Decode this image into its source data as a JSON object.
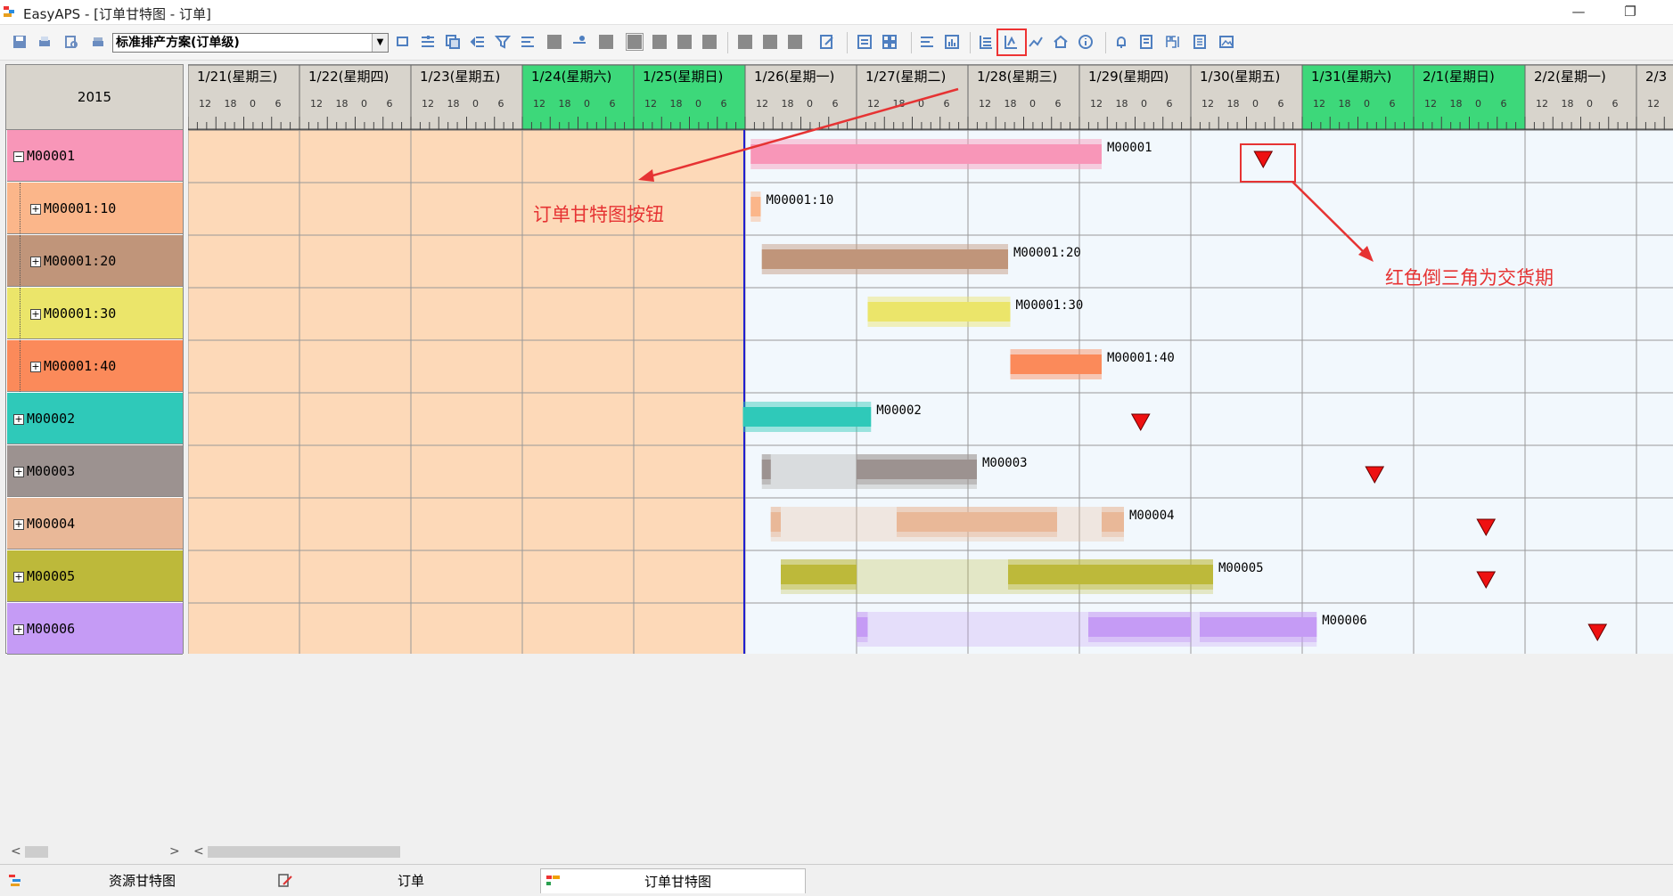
{
  "window": {
    "title": "EasyAPS - [订单甘特图 - 订单]",
    "minimize": "—",
    "restore": "❐"
  },
  "toolbar": {
    "scheme_value": "标准排产方案(订单级)"
  },
  "gantt": {
    "year": "2015",
    "days": [
      {
        "label": "1/21(星期三)",
        "weekend": false
      },
      {
        "label": "1/22(星期四)",
        "weekend": false
      },
      {
        "label": "1/23(星期五)",
        "weekend": false
      },
      {
        "label": "1/24(星期六)",
        "weekend": true
      },
      {
        "label": "1/25(星期日)",
        "weekend": true
      },
      {
        "label": "1/26(星期一)",
        "weekend": false
      },
      {
        "label": "1/27(星期二)",
        "weekend": false
      },
      {
        "label": "1/28(星期三)",
        "weekend": false
      },
      {
        "label": "1/29(星期四)",
        "weekend": false
      },
      {
        "label": "1/30(星期五)",
        "weekend": false
      },
      {
        "label": "1/31(星期六)",
        "weekend": true
      },
      {
        "label": "2/1(星期日)",
        "weekend": true
      },
      {
        "label": "2/2(星期一)",
        "weekend": false
      },
      {
        "label": "2/3",
        "weekend": false
      }
    ],
    "hour_ticks": [
      "12",
      "18",
      "0",
      "6"
    ],
    "colors": {
      "past_bg": "#fdd9b8",
      "future_bg": "#f2f8fd",
      "weekend_header": "#3dd87a",
      "header": "#d8d4cc",
      "now_line": "#1f1fd0",
      "due_marker": "#ee1111"
    },
    "rows": [
      {
        "label": "M00001",
        "expander": "−",
        "indent": false,
        "color": "#f896b8",
        "bar_label": "M00001",
        "due_day": 9.65
      },
      {
        "label": "M00001:10",
        "expander": "+",
        "indent": true,
        "color": "#fbb68a",
        "bar_label": "M00001:10",
        "due_day": null
      },
      {
        "label": "M00001:20",
        "expander": "+",
        "indent": true,
        "color": "#c0957a",
        "bar_label": "M00001:20",
        "due_day": null
      },
      {
        "label": "M00001:30",
        "expander": "+",
        "indent": true,
        "color": "#ebe56a",
        "bar_label": "M00001:30",
        "due_day": null
      },
      {
        "label": "M00001:40",
        "expander": "+",
        "indent": true,
        "color": "#fb8a5a",
        "bar_label": "M00001:40",
        "due_day": null
      },
      {
        "label": "M00002",
        "expander": "+",
        "indent": false,
        "color": "#2fc9b9",
        "bar_label": "M00002",
        "due_day": 8.55
      },
      {
        "label": "M00003",
        "expander": "+",
        "indent": false,
        "color": "#9c9290",
        "bar_label": "M00003",
        "due_day": 10.65
      },
      {
        "label": "M00004",
        "expander": "+",
        "indent": false,
        "color": "#e9b898",
        "bar_label": "M00004",
        "due_day": 11.65
      },
      {
        "label": "M00005",
        "expander": "+",
        "indent": false,
        "color": "#bdb93a",
        "bar_label": "M00005",
        "due_day": 11.65
      },
      {
        "label": "M00006",
        "expander": "+",
        "indent": false,
        "color": "#c59bf5",
        "bar_label": "M00006",
        "due_day": 12.65
      }
    ]
  },
  "annotations": {
    "gantt_button_note": "订单甘特图按钮",
    "due_date_note": "红色倒三角为交货期"
  },
  "tabs": [
    {
      "label": "资源甘特图",
      "active": false
    },
    {
      "label": "订单",
      "active": false
    },
    {
      "label": "订单甘特图",
      "active": true
    }
  ]
}
